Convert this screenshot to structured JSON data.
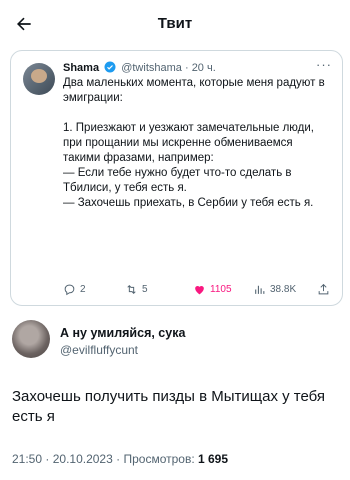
{
  "header": {
    "title": "Твит"
  },
  "quoted": {
    "name": "Shama",
    "handle": "@twitshama",
    "dot": "·",
    "time": "20 ч.",
    "more": "···",
    "text": "Два маленьких момента, которые меня радуют в эмиграции:\n\n1. Приезжают и уезжают замечательные люди, при прощании мы искренне обмениваемся такими фразами, например:\n— Если тебе нужно будет что-то сделать в Тбилиси, у тебя есть я.\n— Захочешь приехать, в Сербии у тебя есть я.",
    "replies": "2",
    "retweets": "5",
    "likes": "1105",
    "views": "38.8K"
  },
  "reply": {
    "name": "А ну умиляйся, сука",
    "handle": "@evilfluffycunt",
    "text": "Захочешь получить пизды в Мытищах у тебя есть я",
    "time": "21:50",
    "date": "20.10.2023",
    "views_label": "Просмотров:",
    "views": "1 695"
  },
  "colors": {
    "like": "#f91880",
    "verified": "#1d9bf0",
    "muted": "#536471"
  }
}
